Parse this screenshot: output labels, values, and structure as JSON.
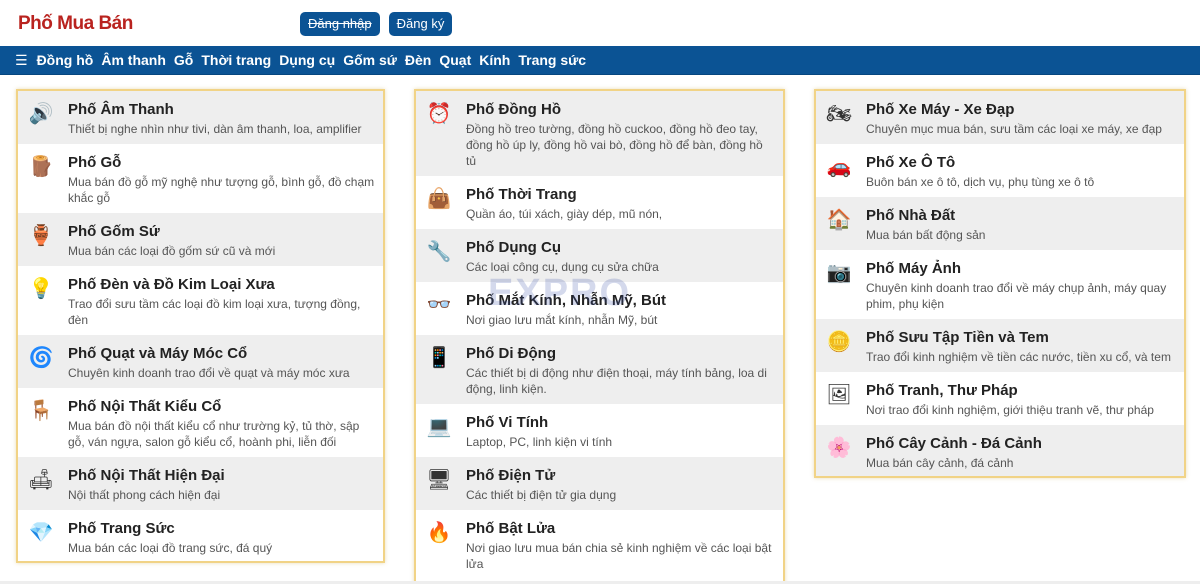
{
  "header": {
    "logo_pho": "Phố",
    "logo_muaban": " Mua Bán",
    "login_label": "Đăng nhập",
    "register_label": "Đăng ký"
  },
  "nav": {
    "items": [
      "Đồng hồ",
      "Âm thanh",
      "Gỗ",
      "Thời trang",
      "Dụng cụ",
      "Gốm sứ",
      "Đèn",
      "Quạt",
      "Kính",
      "Trang sức"
    ]
  },
  "columns": [
    {
      "items": [
        {
          "title": "Phố Âm Thanh",
          "desc": "Thiết bị nghe nhìn như tivi, dàn âm thanh, loa, amplifier",
          "icon": "speaker-icon",
          "glyph": "🔊"
        },
        {
          "title": "Phố Gỗ",
          "desc": "Mua bán đồ gỗ mỹ nghệ như tượng gỗ, bình gỗ, đồ chạm khắc gỗ",
          "icon": "wood-carving-icon",
          "glyph": "🪵"
        },
        {
          "title": "Phố Gốm Sứ",
          "desc": "Mua bán các loại đồ gốm sứ cũ và mới",
          "icon": "ceramic-bowl-icon",
          "glyph": "🏺"
        },
        {
          "title": "Phố Đèn và Đồ Kim Loại Xưa",
          "desc": "Trao đổi sưu tầm các loại đồ kim loại xưa, tượng đồng, đèn",
          "icon": "lamp-icon",
          "glyph": "💡"
        },
        {
          "title": "Phố Quạt và Máy Móc Cổ",
          "desc": "Chuyên kinh doanh trao đổi về quạt và máy móc xưa",
          "icon": "fan-icon",
          "glyph": "🌀"
        },
        {
          "title": "Phố Nội Thất Kiểu Cổ",
          "desc": "Mua bán đồ nội thất kiểu cổ như trường kỷ, tủ thờ, sập gỗ, ván ngựa, salon gỗ kiểu cổ, hoành phi, liễn đối",
          "icon": "antique-furniture-icon",
          "glyph": "🪑"
        },
        {
          "title": "Phố Nội Thất Hiện Đại",
          "desc": "Nội thất phong cách hiện đại",
          "icon": "modern-chair-icon",
          "glyph": "🛋"
        },
        {
          "title": "Phố Trang Sức",
          "desc": "Mua bán các loại đồ trang sức, đá quý",
          "icon": "jewelry-icon",
          "glyph": "💎"
        }
      ]
    },
    {
      "items": [
        {
          "title": "Phố Đồng Hồ",
          "desc": "Đồng hồ treo tường, đồng hồ cuckoo, đồng hồ đeo tay, đồng hồ úp ly, đồng hồ vai bò, đồng hồ để bàn, đồng hồ tủ",
          "icon": "clock-icon",
          "glyph": "⏰"
        },
        {
          "title": "Phố Thời Trang",
          "desc": "Quần áo, túi xách, giày dép, mũ nón,",
          "icon": "fashion-icon",
          "glyph": "👜"
        },
        {
          "title": "Phố Dụng Cụ",
          "desc": "Các loại công cụ, dụng cụ sửa chữa",
          "icon": "tools-icon",
          "glyph": "🔧"
        },
        {
          "title": "Phố Mắt Kính, Nhẫn Mỹ, Bút",
          "desc": "Nơi giao lưu mắt kính, nhẫn Mỹ, bút",
          "icon": "glasses-icon",
          "glyph": "👓"
        },
        {
          "title": "Phố Di Động",
          "desc": "Các thiết bị di động như điện thoại, máy tính bảng, loa di động, linh kiện.",
          "icon": "phone-icon",
          "glyph": "📱"
        },
        {
          "title": "Phố Vi Tính",
          "desc": "Laptop, PC, linh kiện vi tính",
          "icon": "laptop-icon",
          "glyph": "💻"
        },
        {
          "title": "Phố Điện Tử",
          "desc": "Các thiết bị điện tử gia dụng",
          "icon": "tv-icon",
          "glyph": "🖥"
        },
        {
          "title": "Phố Bật Lửa",
          "desc": "Nơi giao lưu mua bán chia sẻ kinh nghiệm về các loại bật lửa",
          "icon": "lighter-icon",
          "glyph": "🔥"
        }
      ]
    },
    {
      "items": [
        {
          "title": "Phố Xe Máy - Xe Đạp",
          "desc": "Chuyên mục mua bán, sưu tầm các loại xe máy, xe đạp",
          "icon": "motorbike-icon",
          "glyph": "🏍"
        },
        {
          "title": "Phố Xe Ô Tô",
          "desc": "Buôn bán xe ô tô, dịch vụ, phụ tùng xe ô tô",
          "icon": "car-icon",
          "glyph": "🚗"
        },
        {
          "title": "Phố Nhà Đất",
          "desc": "Mua bán bất động sản",
          "icon": "house-icon",
          "glyph": "🏠"
        },
        {
          "title": "Phố Máy Ảnh",
          "desc": "Chuyên kinh doanh trao đổi về máy chụp ảnh, máy quay phim, phụ kiện",
          "icon": "camera-icon",
          "glyph": "📷"
        },
        {
          "title": "Phố Sưu Tập Tiền và Tem",
          "desc": "Trao đổi kinh nghiệm về tiền các nước, tiền xu cổ, và tem",
          "icon": "coin-icon",
          "glyph": "🪙"
        },
        {
          "title": "Phố Tranh, Thư Pháp",
          "desc": "Nơi trao đổi kinh nghiệm, giới thiệu tranh vẽ, thư pháp",
          "icon": "painting-icon",
          "glyph": "🖼"
        },
        {
          "title": "Phố Cây Cảnh - Đá Cảnh",
          "desc": "Mua bán cây cảnh, đá cảnh",
          "icon": "flower-icon",
          "glyph": "🌸"
        }
      ]
    }
  ],
  "watermark": "EXPRO",
  "colors": {
    "brand_red": "#b9231f",
    "nav_blue": "#0b5394",
    "card_border": "#f1d386",
    "row_shade": "#eeeeee"
  }
}
